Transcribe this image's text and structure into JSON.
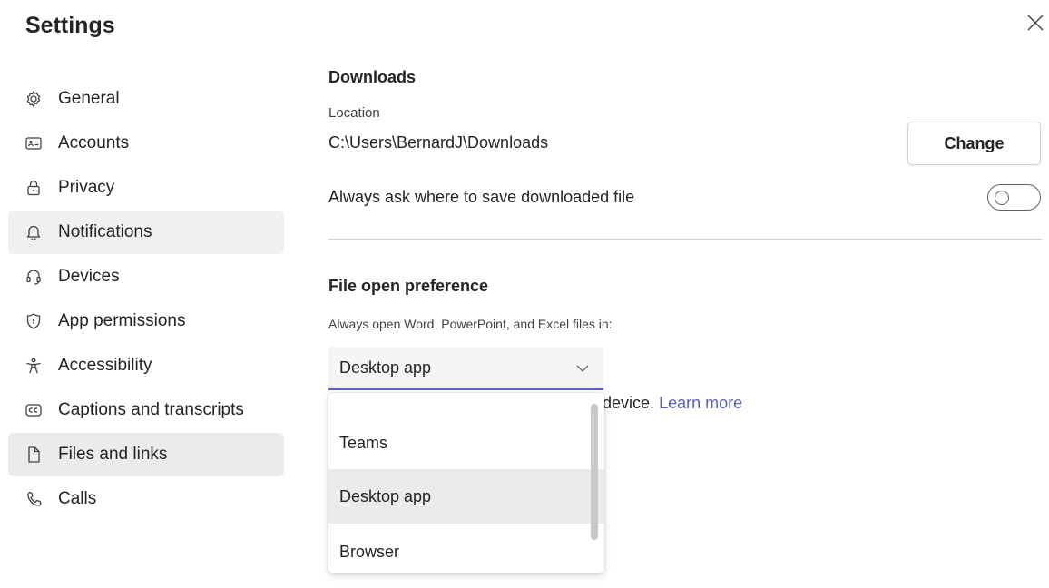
{
  "header": {
    "title": "Settings",
    "close_icon": "close-icon"
  },
  "sidebar": {
    "items": [
      {
        "label": "General",
        "icon": "gear-icon"
      },
      {
        "label": "Accounts",
        "icon": "id-card-icon"
      },
      {
        "label": "Privacy",
        "icon": "lock-icon"
      },
      {
        "label": "Notifications",
        "icon": "bell-icon"
      },
      {
        "label": "Devices",
        "icon": "headset-icon"
      },
      {
        "label": "App permissions",
        "icon": "shield-icon"
      },
      {
        "label": "Accessibility",
        "icon": "accessibility-icon"
      },
      {
        "label": "Captions and transcripts",
        "icon": "captions-icon"
      },
      {
        "label": "Files and links",
        "icon": "file-icon"
      },
      {
        "label": "Calls",
        "icon": "phone-icon"
      }
    ],
    "selected": "Files and links",
    "hovered": "Notifications"
  },
  "downloads": {
    "title": "Downloads",
    "location_label": "Location",
    "location_path": "C:\\Users\\BernardJ\\Downloads",
    "change_label": "Change",
    "always_ask_label": "Always ask where to save downloaded file",
    "always_ask_on": false
  },
  "file_open": {
    "title": "File open preference",
    "description": "Always open Word, PowerPoint, and Excel files in:",
    "selected": "Desktop app",
    "partial_text": "s device.",
    "learn_more": "Learn more",
    "options": [
      "Teams",
      "Desktop app",
      "Browser"
    ]
  },
  "colors": {
    "accent": "#5b5fc7",
    "selected_bg": "#ebebeb",
    "hover_bg": "#f0f0f0"
  }
}
